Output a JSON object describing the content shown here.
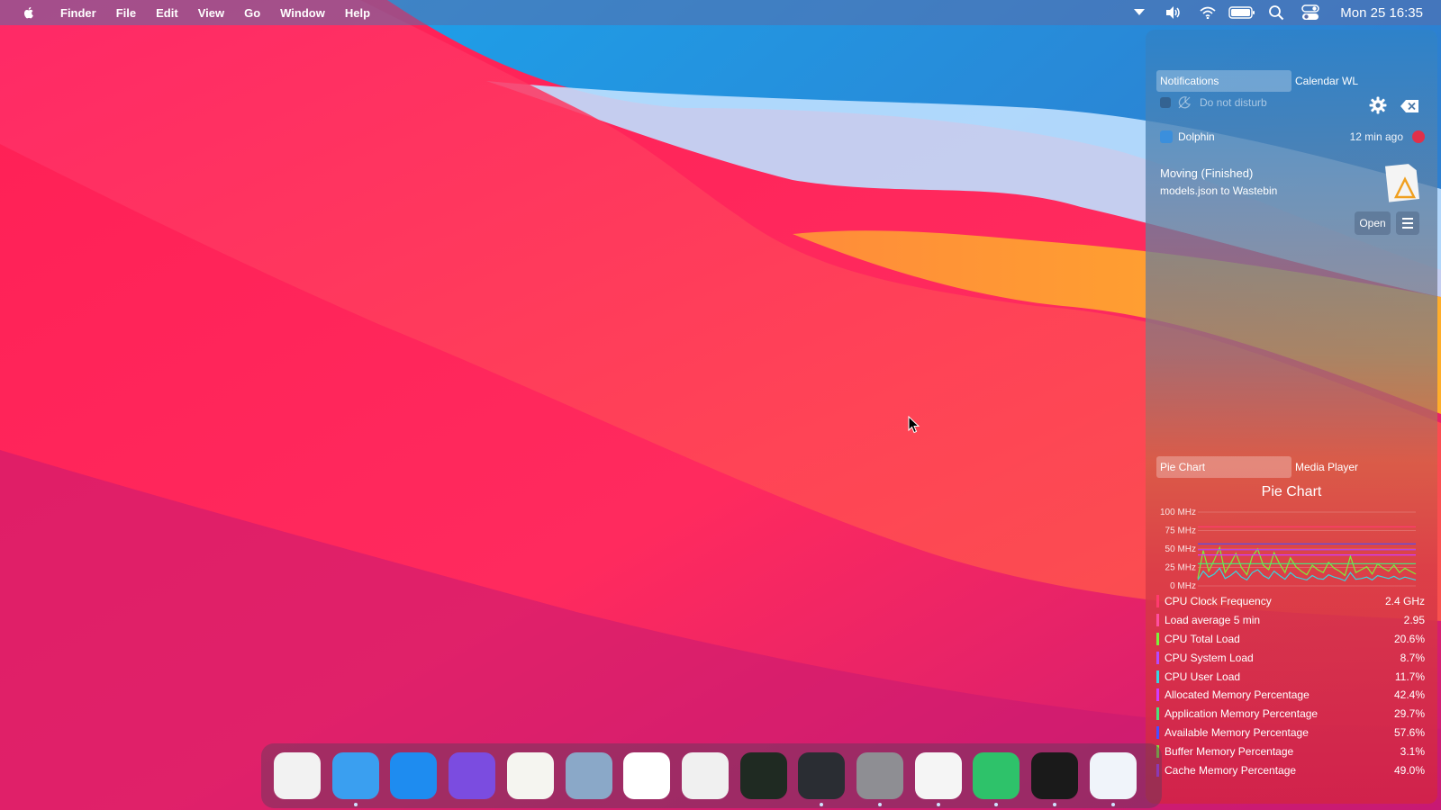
{
  "menubar": {
    "app_name": "Finder",
    "items": [
      "File",
      "Edit",
      "View",
      "Go",
      "Window",
      "Help"
    ],
    "clock": "Mon 25 16:35",
    "tray_icons": [
      "dropdown-arrow-icon",
      "volume-icon",
      "wifi-icon",
      "battery-icon",
      "search-icon",
      "control-center-icon"
    ]
  },
  "panel": {
    "top_tabs": [
      "Notifications",
      "Calendar WL"
    ],
    "do_not_disturb": "Do not disturb",
    "notification": {
      "app": "Dolphin",
      "time": "12 min ago",
      "title": "Moving (Finished)",
      "body": "models.json to Wastebin",
      "open_label": "Open"
    },
    "bottom_tabs": [
      "Pie Chart",
      "Media Player"
    ],
    "widget_title": "Pie Chart"
  },
  "chart_data": {
    "type": "line",
    "y_ticks": [
      "100 MHz",
      "75 MHz",
      "50 MHz",
      "25 MHz",
      "0 MHz"
    ],
    "ylim": [
      0,
      100
    ],
    "grid": true,
    "legend": [
      {
        "name": "CPU Clock Frequency",
        "value": "2.4 GHz",
        "color": "#ff3b6e"
      },
      {
        "name": "Load average 5 min",
        "value": "2.95",
        "color": "#ff4fa0"
      },
      {
        "name": "CPU Total Load",
        "value": "20.6%",
        "color": "#7cf23a"
      },
      {
        "name": "CPU System Load",
        "value": "8.7%",
        "color": "#b548ff"
      },
      {
        "name": "CPU User Load",
        "value": "11.7%",
        "color": "#37d6e0"
      },
      {
        "name": "Allocated Memory Percentage",
        "value": "42.4%",
        "color": "#d13bff"
      },
      {
        "name": "Application Memory Percentage",
        "value": "29.7%",
        "color": "#4fe07a"
      },
      {
        "name": "Available Memory Percentage",
        "value": "57.6%",
        "color": "#4a4dff"
      },
      {
        "name": "Buffer Memory Percentage",
        "value": "3.1%",
        "color": "#8be03a"
      },
      {
        "name": "Cache Memory Percentage",
        "value": "49.0%",
        "color": "#b238ff"
      }
    ],
    "series": [
      {
        "name": "CPU Clock Frequency",
        "values": [
          80,
          80,
          80,
          80,
          80,
          80,
          80,
          80,
          80,
          80,
          80,
          80,
          80,
          80,
          80,
          80,
          80,
          80,
          80,
          80,
          80,
          80,
          80,
          80,
          80,
          80,
          80,
          80,
          80,
          80,
          80,
          80,
          80,
          80,
          80,
          80,
          80,
          80,
          80,
          80,
          80
        ]
      },
      {
        "name": "CPU Total Load",
        "values": [
          10,
          48,
          20,
          35,
          52,
          18,
          30,
          44,
          25,
          15,
          40,
          50,
          28,
          22,
          45,
          30,
          18,
          38,
          26,
          20,
          15,
          28,
          22,
          18,
          32,
          24,
          20,
          14,
          40,
          18,
          22,
          26,
          16,
          30,
          24,
          20,
          28,
          18,
          24,
          20,
          16
        ]
      },
      {
        "name": "CPU User Load",
        "values": [
          8,
          20,
          12,
          16,
          24,
          10,
          14,
          20,
          12,
          8,
          18,
          22,
          14,
          10,
          20,
          14,
          9,
          18,
          12,
          10,
          8,
          14,
          10,
          9,
          15,
          12,
          10,
          7,
          18,
          9,
          10,
          12,
          8,
          14,
          12,
          10,
          13,
          9,
          12,
          10,
          8
        ]
      },
      {
        "name": "Available Memory Percentage",
        "values": [
          57,
          57,
          57,
          57,
          57,
          57,
          57,
          57,
          57,
          57,
          57,
          57,
          57,
          57,
          57,
          57,
          57,
          57,
          57,
          57,
          57,
          57,
          57,
          57,
          57,
          57,
          57,
          57,
          57,
          57,
          57,
          57,
          57,
          57,
          57,
          57,
          57,
          57,
          57,
          57,
          57
        ]
      },
      {
        "name": "Cache Memory Percentage",
        "values": [
          49,
          49,
          49,
          49,
          49,
          49,
          49,
          49,
          49,
          49,
          49,
          49,
          49,
          49,
          49,
          49,
          49,
          49,
          49,
          49,
          49,
          49,
          49,
          49,
          49,
          49,
          49,
          49,
          49,
          49,
          49,
          49,
          49,
          49,
          49,
          49,
          49,
          49,
          49,
          49,
          49
        ]
      },
      {
        "name": "Allocated Memory Percentage",
        "values": [
          42,
          42,
          42,
          42,
          42,
          42,
          42,
          42,
          42,
          42,
          42,
          42,
          42,
          42,
          42,
          42,
          42,
          42,
          42,
          42,
          42,
          42,
          42,
          42,
          42,
          42,
          42,
          42,
          42,
          42,
          42,
          42,
          42,
          42,
          42,
          42,
          42,
          42,
          42,
          42,
          42
        ]
      },
      {
        "name": "Application Memory Percentage",
        "values": [
          30,
          30,
          30,
          30,
          30,
          30,
          30,
          30,
          30,
          30,
          30,
          30,
          30,
          30,
          30,
          30,
          30,
          30,
          30,
          30,
          30,
          30,
          30,
          30,
          30,
          30,
          30,
          30,
          30,
          30,
          30,
          30,
          30,
          30,
          30,
          30,
          30,
          30,
          30,
          30,
          30
        ]
      }
    ]
  },
  "dock": {
    "apps": [
      {
        "name": "launchpad-icon",
        "color": "#f2f2f2"
      },
      {
        "name": "finder-icon",
        "color": "#3a9ff0"
      },
      {
        "name": "app-store-icon",
        "color": "#1e8cf0"
      },
      {
        "name": "firefox-icon",
        "color": "#7b4ce0"
      },
      {
        "name": "text-editor-icon",
        "color": "#f5f5f0"
      },
      {
        "name": "preview-icon",
        "color": "#8aa8c8"
      },
      {
        "name": "photos-icon",
        "color": "#ffffff"
      },
      {
        "name": "screenshot-icon",
        "color": "#f0f0f0"
      },
      {
        "name": "activity-monitor-icon",
        "color": "#1f2a22"
      },
      {
        "name": "terminal-icon",
        "color": "#2a2d33"
      },
      {
        "name": "system-settings-icon",
        "color": "#8e8e93"
      },
      {
        "name": "brave-icon",
        "color": "#f5f5f5"
      },
      {
        "name": "download-manager-icon",
        "color": "#2ec26a"
      },
      {
        "name": "spotify-icon",
        "color": "#1a1a1a"
      },
      {
        "name": "visual-studio-code-icon",
        "color": "#f0f4fa"
      }
    ]
  }
}
